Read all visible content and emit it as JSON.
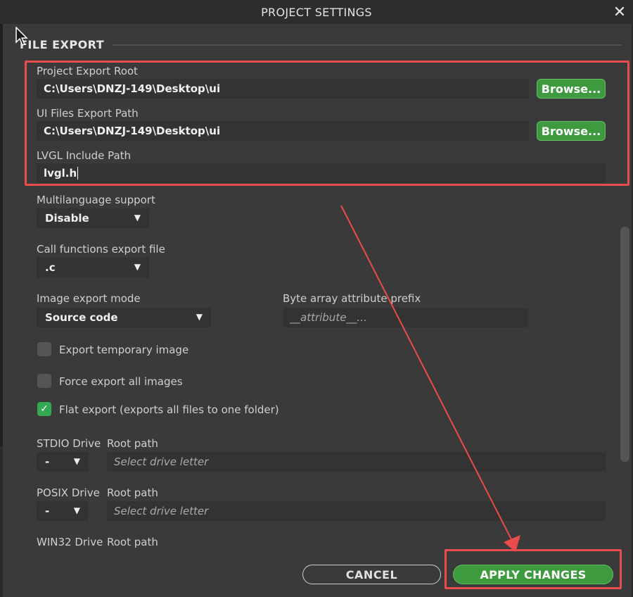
{
  "window": {
    "title": "PROJECT SETTINGS"
  },
  "section": {
    "title": "FILE EXPORT"
  },
  "export": {
    "project_root_label": "Project Export Root",
    "project_root_value": "C:\\Users\\DNZJ-149\\Desktop\\ui",
    "ui_files_label": "UI Files Export Path",
    "ui_files_value": "C:\\Users\\DNZJ-149\\Desktop\\ui",
    "lvgl_label": "LVGL Include Path",
    "lvgl_value": "lvgl.h",
    "browse_label": "Browse..."
  },
  "multilanguage": {
    "label": "Multilanguage support",
    "value": "Disable"
  },
  "call_functions": {
    "label": "Call functions export file",
    "value": ".c"
  },
  "image_mode": {
    "label": "Image export mode",
    "value": "Source code"
  },
  "byte_prefix": {
    "label": "Byte array attribute prefix",
    "placeholder": "__attribute__..."
  },
  "checkboxes": [
    {
      "label": "Export temporary image",
      "checked": false
    },
    {
      "label": "Force export all images",
      "checked": false
    },
    {
      "label": "Flat export (exports all files to one folder)",
      "checked": true
    }
  ],
  "drives": [
    {
      "label": "STDIO Drive",
      "root_label": "Root path",
      "value": "-",
      "placeholder": "Select drive letter"
    },
    {
      "label": "POSIX Drive",
      "root_label": "Root path",
      "value": "-",
      "placeholder": "Select drive letter"
    },
    {
      "label": "WIN32 Drive",
      "root_label": "Root path"
    }
  ],
  "footer": {
    "cancel_label": "CANCEL",
    "apply_label": "APPLY CHANGES"
  },
  "icons": {
    "close": "close-icon",
    "dropdown": "chevron-down-icon",
    "check": "check-icon",
    "cursor": "mouse-cursor-icon"
  },
  "colors": {
    "accent_green": "#3e9a3e",
    "annotation_red": "#e84c4c",
    "panel_bg": "#3a3a3a"
  }
}
